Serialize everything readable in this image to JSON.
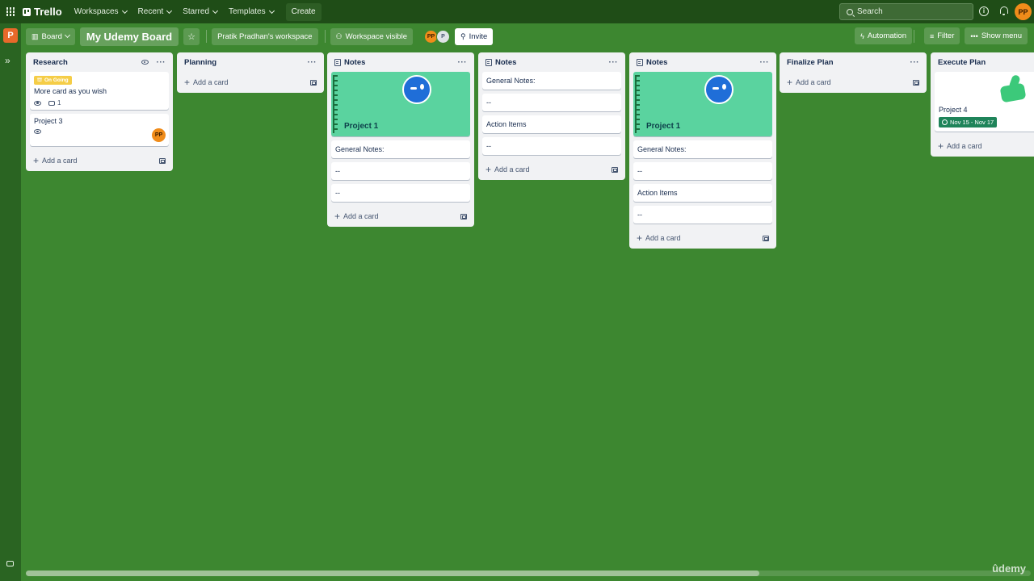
{
  "topbar": {
    "logo": "Trello",
    "nav": [
      "Workspaces",
      "Recent",
      "Starred",
      "Templates"
    ],
    "create": "Create",
    "search_placeholder": "Search",
    "user_initials": "PP"
  },
  "sidebar": {
    "workspace_initial": "P",
    "expand_glyph": "»"
  },
  "board": {
    "view_label": "Board",
    "title": "My Udemy Board",
    "workspace": "Pratik Pradhan's workspace",
    "visibility": "Workspace visible",
    "members": [
      "PP",
      "P"
    ],
    "invite": "Invite",
    "automation": "Automation",
    "filter": "Filter",
    "show_menu": "Show menu"
  },
  "lists": {
    "research": {
      "title": "Research",
      "card1": {
        "label": "On Going",
        "title": "More card as you wish",
        "comments": "1"
      },
      "card2": {
        "title": "Project 3",
        "avatar": "PP"
      },
      "add": "Add a card"
    },
    "planning": {
      "title": "Planning",
      "add": "Add a card"
    },
    "notes1": {
      "title": "Notes",
      "cover_title": "Project 1",
      "cards": [
        "General Notes:",
        "--",
        "--"
      ],
      "add": "Add a card"
    },
    "notes2": {
      "title": "Notes",
      "cards": [
        "General Notes:",
        "--",
        "Action Items",
        "--"
      ],
      "add": "Add a card"
    },
    "notes3": {
      "title": "Notes",
      "cover_title": "Project 1",
      "cards": [
        "General Notes:",
        "--",
        "Action Items",
        "--"
      ],
      "add": "Add a card"
    },
    "finalize": {
      "title": "Finalize Plan",
      "add": "Add a card"
    },
    "execute": {
      "title": "Execute Plan",
      "card_title": "Project 4",
      "dates": "Nov 15 - Nov 17",
      "add": "Add a card"
    }
  },
  "watermark": "ûdemy",
  "colors": {
    "board_bg": "#3d8730",
    "header_bg": "#1f4d17",
    "cover": "#5ad39f",
    "date_badge": "#1f845a",
    "label": "#f5cd47"
  }
}
